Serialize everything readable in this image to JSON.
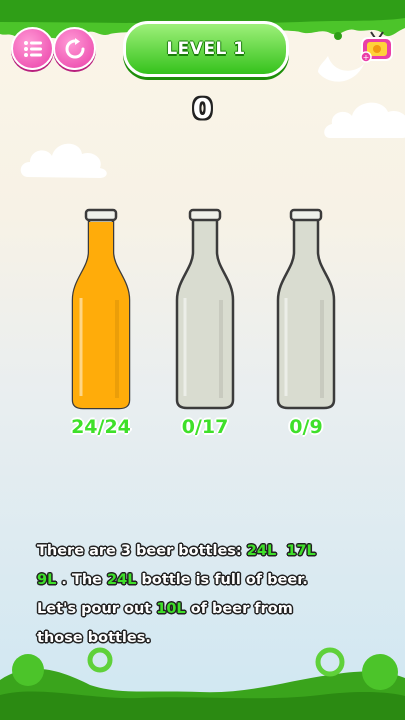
{
  "header": {
    "level_label": "LEVEL 1",
    "menu_icon": "list-icon",
    "restart_icon": "restart-icon",
    "tv_icon": "tv-reward-icon"
  },
  "score": "0",
  "bottles": [
    {
      "label": "24/24",
      "fill_fraction": 1.0,
      "color": "#ffac0a"
    },
    {
      "label": "0/17",
      "fill_fraction": 0.0,
      "color": "#ffac0a"
    },
    {
      "label": "0/9",
      "fill_fraction": 0.0,
      "color": "#ffac0a"
    }
  ],
  "description": {
    "p1": "There are 3 beer bottles: ",
    "v1": "24L",
    "v2": "17L",
    "v3": "9L",
    "p2": " . The ",
    "v4": "24L",
    "p3": " bottle is full of beer.",
    "p4": "Let's pour out ",
    "v5": "10L",
    "p5": " of beer from",
    "p6": "those bottles."
  },
  "colors": {
    "accent_green": "#3fe02a",
    "pink": "#ea3fa8",
    "beer": "#ffac0a"
  }
}
